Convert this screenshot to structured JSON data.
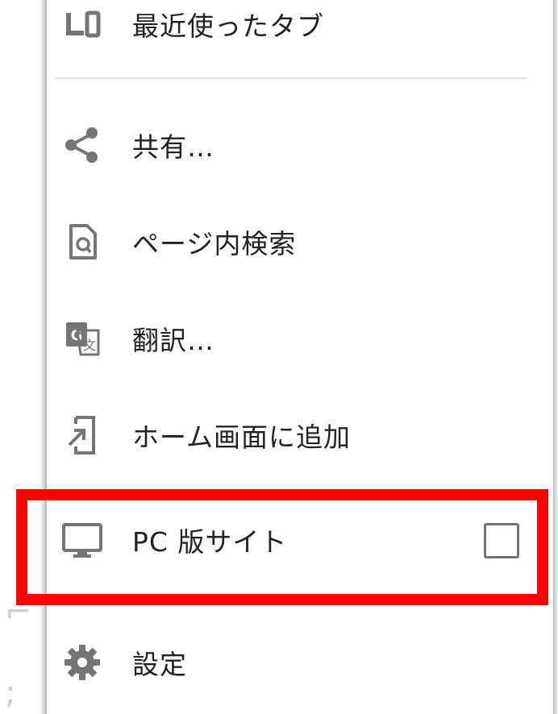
{
  "menu": {
    "items": [
      {
        "label": "最近使ったタブ",
        "icon": "recent-tabs-icon"
      },
      {
        "label": "共有…",
        "icon": "share-icon"
      },
      {
        "label": "ページ内検索",
        "icon": "find-in-page-icon"
      },
      {
        "label": "翻訳…",
        "icon": "translate-icon"
      },
      {
        "label": "ホーム画面に追加",
        "icon": "add-to-home-icon"
      },
      {
        "label": "PC 版サイト",
        "icon": "desktop-icon",
        "checked": false
      },
      {
        "label": "設定",
        "icon": "gear-icon"
      }
    ]
  },
  "colors": {
    "icon": "#757575",
    "text": "#222222",
    "highlight": "#ff0000"
  }
}
